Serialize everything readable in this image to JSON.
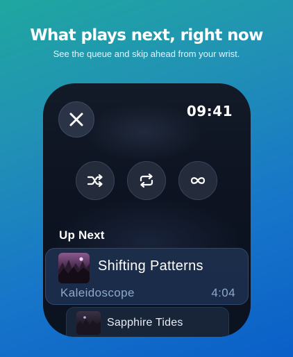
{
  "promo": {
    "headline": "What plays next, right now",
    "subline": "See the queue and skip ahead from your wrist."
  },
  "watch": {
    "time": "09:41",
    "close_icon": "close-icon",
    "controls": [
      {
        "name": "shuffle",
        "icon": "shuffle-icon"
      },
      {
        "name": "repeat",
        "icon": "repeat-icon"
      },
      {
        "name": "infinite",
        "icon": "infinity-icon"
      }
    ],
    "up_next_label": "Up Next",
    "queue": [
      {
        "title": "Shifting Patterns",
        "artist": "Kaleidoscope",
        "duration": "4:04"
      },
      {
        "title": "Sapphire Tides"
      }
    ]
  },
  "colors": {
    "background_top": "#1fa7a0",
    "background_bottom": "#0a5fc8",
    "card_accent": "#2e4a72",
    "secondary_text": "#8fa9cb"
  }
}
